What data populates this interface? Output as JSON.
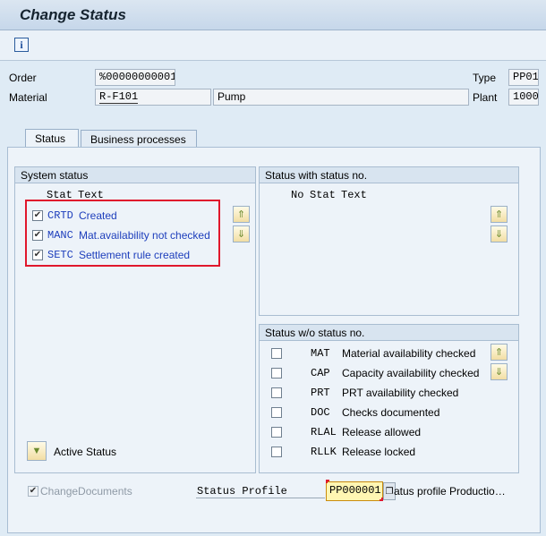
{
  "header": {
    "title": "Change Status"
  },
  "fields": {
    "order_label": "Order",
    "order_value": "%00000000001",
    "type_label": "Type",
    "type_value": "PP01",
    "material_label": "Material",
    "material_value": "R-F101",
    "material_desc": "Pump",
    "plant_label": "Plant",
    "plant_value": "1000"
  },
  "tabs": [
    {
      "label": "Status",
      "active": true
    },
    {
      "label": "Business processes",
      "active": false
    }
  ],
  "system_status": {
    "title": "System status",
    "col_stat": "Stat",
    "col_text": "Text",
    "rows": [
      {
        "stat": "CRTD",
        "text": "Created",
        "checked": true
      },
      {
        "stat": "MANC",
        "text": "Mat.availability not checked",
        "checked": true
      },
      {
        "stat": "SETC",
        "text": "Settlement rule created",
        "checked": true
      }
    ]
  },
  "status_with_no": {
    "title": "Status with status no.",
    "col_no": "No",
    "col_stat": "Stat",
    "col_text": "Text"
  },
  "status_wo_no": {
    "title": "Status w/o status no.",
    "rows": [
      {
        "stat": "MAT",
        "text": "Material availability checked",
        "checked": false
      },
      {
        "stat": "CAP",
        "text": "Capacity availability checked",
        "checked": false
      },
      {
        "stat": "PRT",
        "text": "PRT availability checked",
        "checked": false
      },
      {
        "stat": "DOC",
        "text": "Checks documented",
        "checked": false
      },
      {
        "stat": "RLAL",
        "text": "Release allowed",
        "checked": false
      },
      {
        "stat": "RLLK",
        "text": "Release locked",
        "checked": false
      }
    ]
  },
  "active_status_label": "Active Status",
  "change_documents_label": "ChangeDocuments",
  "status_profile": {
    "label": "Status Profile",
    "value": "PP000001",
    "desc": "atus profile Productio…"
  },
  "colors": {
    "highlight_border": "#e0172c",
    "status_text_blue": "#1d3ebc"
  }
}
